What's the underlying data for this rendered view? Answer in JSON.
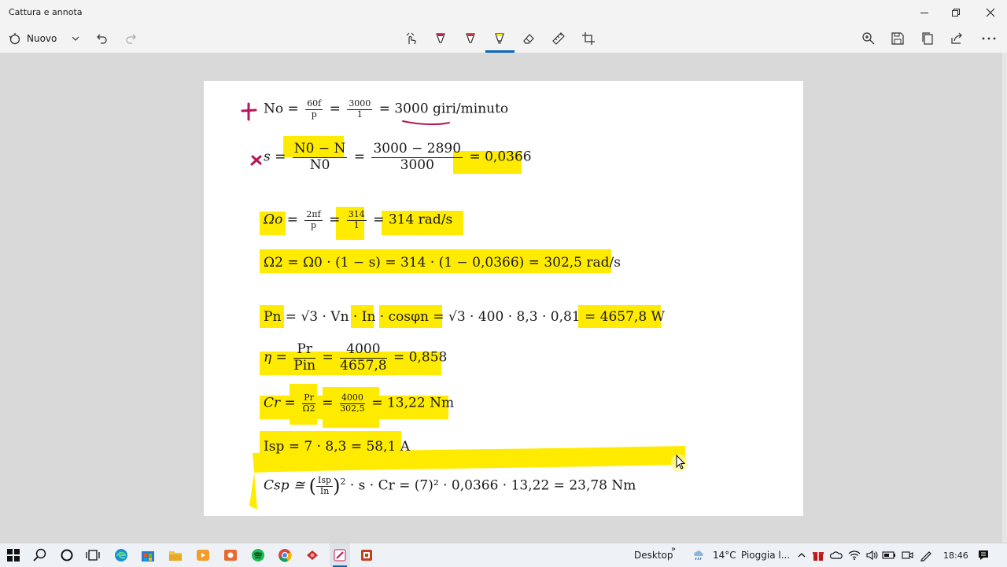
{
  "window": {
    "title": "Cattura e annota"
  },
  "toolbar": {
    "new_label": "Nuovo",
    "icons": [
      "new-snip-icon",
      "chevron-down-icon",
      "undo-icon",
      "redo-icon",
      "touch-writing-icon",
      "ballpoint-pen-icon",
      "pencil-icon",
      "highlighter-icon",
      "eraser-icon",
      "ruler-icon",
      "crop-icon",
      "zoom-icon",
      "save-icon",
      "copy-icon",
      "share-icon",
      "more-icon"
    ],
    "active_tool": "highlighter",
    "accent_color": "#0a66b8"
  },
  "document": {
    "highlight_color": "#ffeb00",
    "ink_color": "#b5175a",
    "eq1": {
      "lhs": "No =",
      "frac1_num": "60f",
      "frac1_den": "p",
      "eq_a": "=",
      "frac2_num": "3000",
      "frac2_den": "1",
      "rhs": "= 3000 giri/minuto"
    },
    "eq2": {
      "lhs": "s =",
      "frac1_num": "N0 − N",
      "frac1_den": "N0",
      "eq_a": "=",
      "frac2_num": "3000 − 2890",
      "frac2_den": "3000",
      "rhs": "= 0,0366"
    },
    "eq3": {
      "lhs": "Ωo =",
      "frac1_num": "2πf",
      "frac1_den": "p",
      "eq_a": "=",
      "frac2_num": "314",
      "frac2_den": "1",
      "rhs": "= 314 rad/s"
    },
    "eq4": "Ω2 = Ω0 · (1 − s) = 314 · (1 − 0,0366) = 302,5 rad/s",
    "eq5": "Pn = √3 · Vn · In · cosφn = √3 · 400 · 8,3 · 0,81 = 4657,8 W",
    "eq6": {
      "lhs": "η =",
      "frac1_num": "Pr",
      "frac1_den": "Pin",
      "eq_a": "=",
      "frac2_num": "4000",
      "frac2_den": "4657,8",
      "rhs": "= 0,858"
    },
    "eq7": {
      "lhs": "Cr =",
      "frac1_num": "Pr",
      "frac1_den": "Ω2",
      "eq_a": "=",
      "frac2_num": "4000",
      "frac2_den": "302,5",
      "rhs": "= 13,22 Nm"
    },
    "eq8": "Isp = 7 · 8,3 = 58,1 A",
    "eq9": {
      "lhs": "Csp ≅",
      "frac_num": "Isp",
      "frac_den": "In",
      "exp": "2",
      "rhs": "· s · Cr = (7)² · 0,0366 · 13,22 = 23,78 Nm"
    }
  },
  "taskbar": {
    "desktop_label": "Desktop",
    "overflow": "»",
    "weather_temp": "14°C",
    "weather_text": "Pioggia l...",
    "time": "18:46",
    "app_icons": [
      "windows-start-icon",
      "search-icon",
      "cortana-icon",
      "task-view-icon",
      "edge-icon",
      "store-icon",
      "file-explorer-icon",
      "media-player-icon",
      "photos-icon",
      "spotify-icon",
      "chrome-icon",
      "app-red-icon",
      "snip-sketch-icon",
      "powerpoint-icon"
    ]
  }
}
